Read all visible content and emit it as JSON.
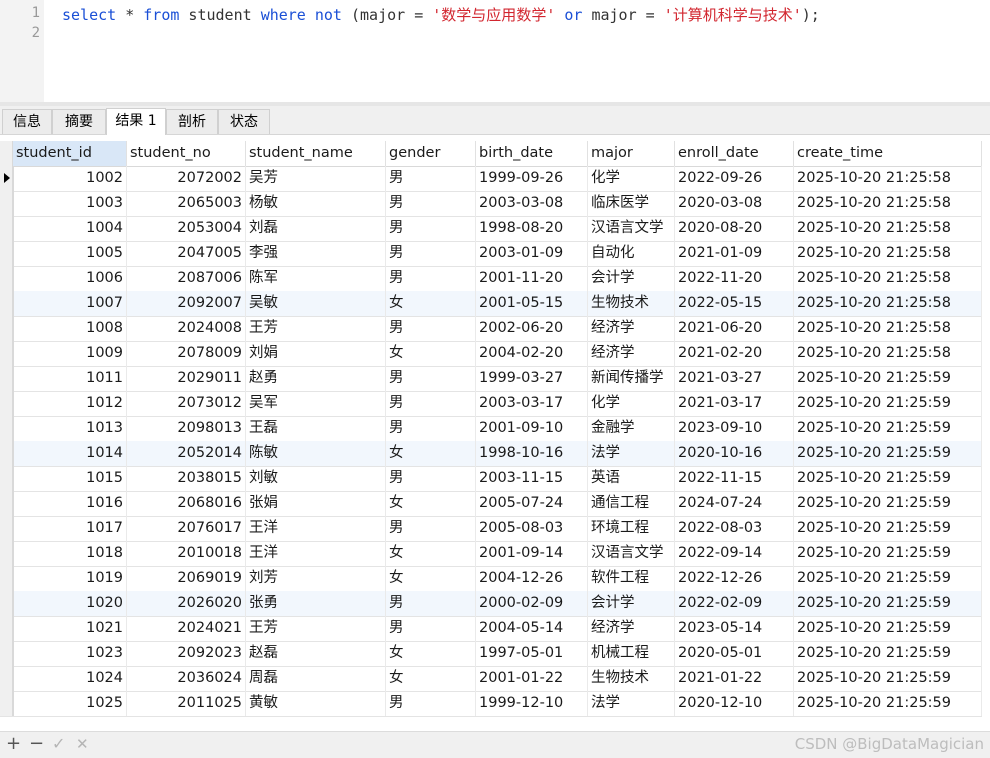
{
  "editor": {
    "line_numbers": [
      "1",
      "2"
    ],
    "query_tokens": {
      "t1": "select",
      "t2": " * ",
      "t3": "from",
      "t4": " student ",
      "t5": "where",
      "t6": " ",
      "t7": "not",
      "t8": " (major = ",
      "t9": "'数学与应用数学'",
      "t10": " ",
      "t11": "or",
      "t12": " major = ",
      "t13": "'计算机科学与技术'",
      "t14": ");"
    }
  },
  "tabs": [
    "信息",
    "摘要",
    "结果 1",
    "剖析",
    "状态"
  ],
  "active_tab": "结果 1",
  "grid": {
    "columns": [
      "student_id",
      "student_no",
      "student_name",
      "gender",
      "birth_date",
      "major",
      "enroll_date",
      "create_time"
    ],
    "rows": [
      [
        "1002",
        "2072002",
        "吴芳",
        "男",
        "1999-09-26",
        "化学",
        "2022-09-26",
        "2025-10-20 21:25:58"
      ],
      [
        "1003",
        "2065003",
        "杨敏",
        "男",
        "2003-03-08",
        "临床医学",
        "2020-03-08",
        "2025-10-20 21:25:58"
      ],
      [
        "1004",
        "2053004",
        "刘磊",
        "男",
        "1998-08-20",
        "汉语言文学",
        "2020-08-20",
        "2025-10-20 21:25:58"
      ],
      [
        "1005",
        "2047005",
        "李强",
        "男",
        "2003-01-09",
        "自动化",
        "2021-01-09",
        "2025-10-20 21:25:58"
      ],
      [
        "1006",
        "2087006",
        "陈军",
        "男",
        "2001-11-20",
        "会计学",
        "2022-11-20",
        "2025-10-20 21:25:58"
      ],
      [
        "1007",
        "2092007",
        "吴敏",
        "女",
        "2001-05-15",
        "生物技术",
        "2022-05-15",
        "2025-10-20 21:25:58"
      ],
      [
        "1008",
        "2024008",
        "王芳",
        "男",
        "2002-06-20",
        "经济学",
        "2021-06-20",
        "2025-10-20 21:25:58"
      ],
      [
        "1009",
        "2078009",
        "刘娟",
        "女",
        "2004-02-20",
        "经济学",
        "2021-02-20",
        "2025-10-20 21:25:58"
      ],
      [
        "1011",
        "2029011",
        "赵勇",
        "男",
        "1999-03-27",
        "新闻传播学",
        "2021-03-27",
        "2025-10-20 21:25:59"
      ],
      [
        "1012",
        "2073012",
        "吴军",
        "男",
        "2003-03-17",
        "化学",
        "2021-03-17",
        "2025-10-20 21:25:59"
      ],
      [
        "1013",
        "2098013",
        "王磊",
        "男",
        "2001-09-10",
        "金融学",
        "2023-09-10",
        "2025-10-20 21:25:59"
      ],
      [
        "1014",
        "2052014",
        "陈敏",
        "女",
        "1998-10-16",
        "法学",
        "2020-10-16",
        "2025-10-20 21:25:59"
      ],
      [
        "1015",
        "2038015",
        "刘敏",
        "男",
        "2003-11-15",
        "英语",
        "2022-11-15",
        "2025-10-20 21:25:59"
      ],
      [
        "1016",
        "2068016",
        "张娟",
        "女",
        "2005-07-24",
        "通信工程",
        "2024-07-24",
        "2025-10-20 21:25:59"
      ],
      [
        "1017",
        "2076017",
        "王洋",
        "男",
        "2005-08-03",
        "环境工程",
        "2022-08-03",
        "2025-10-20 21:25:59"
      ],
      [
        "1018",
        "2010018",
        "王洋",
        "女",
        "2001-09-14",
        "汉语言文学",
        "2022-09-14",
        "2025-10-20 21:25:59"
      ],
      [
        "1019",
        "2069019",
        "刘芳",
        "女",
        "2004-12-26",
        "软件工程",
        "2022-12-26",
        "2025-10-20 21:25:59"
      ],
      [
        "1020",
        "2026020",
        "张勇",
        "男",
        "2000-02-09",
        "会计学",
        "2022-02-09",
        "2025-10-20 21:25:59"
      ],
      [
        "1021",
        "2024021",
        "王芳",
        "男",
        "2004-05-14",
        "经济学",
        "2023-05-14",
        "2025-10-20 21:25:59"
      ],
      [
        "1023",
        "2092023",
        "赵磊",
        "女",
        "1997-05-01",
        "机械工程",
        "2020-05-01",
        "2025-10-20 21:25:59"
      ],
      [
        "1024",
        "2036024",
        "周磊",
        "女",
        "2001-01-22",
        "生物技术",
        "2021-01-22",
        "2025-10-20 21:25:59"
      ],
      [
        "1025",
        "2011025",
        "黄敏",
        "男",
        "1999-12-10",
        "法学",
        "2020-12-10",
        "2025-10-20 21:25:59"
      ]
    ]
  },
  "bottom": {
    "add": "+",
    "remove": "−",
    "apply": "✓",
    "discard": "✕",
    "watermark": "CSDN @BigDataMagician"
  },
  "colors": {
    "keyword": "#1a4fd6",
    "string": "#d2262f",
    "selected_header": "#d9e7f7",
    "alt_row": "#f2f7fd"
  }
}
